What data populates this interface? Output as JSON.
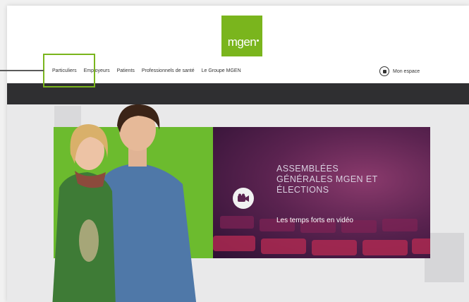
{
  "logo": {
    "text": "mgen"
  },
  "nav": {
    "items": [
      {
        "label": "Particuliers"
      },
      {
        "label": "Employeurs"
      },
      {
        "label": "Patients"
      },
      {
        "label": "Professionnels de santé"
      },
      {
        "label": "Le Groupe MGEN"
      }
    ]
  },
  "account": {
    "label": "Mon espace"
  },
  "banner": {
    "title": "ASSEMBLÉES GÉNÉRALES MGEN ET ÉLECTIONS",
    "subtitle": "Les temps forts en vidéo"
  },
  "colors": {
    "brand_green": "#7ab51d",
    "panel_green": "#6cbb2e",
    "dark_bar": "#2f2f31",
    "banner_purple": "#5b2350"
  },
  "icons": {
    "account": "lock-icon",
    "video": "video-camera-icon"
  }
}
